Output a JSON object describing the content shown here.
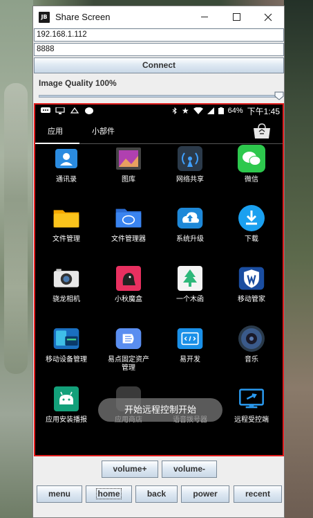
{
  "window": {
    "title": "Share Screen",
    "app_icon_text": "JB"
  },
  "connection": {
    "ip_value": "192.168.1.112",
    "port_value": "8888",
    "connect_label": "Connect"
  },
  "quality": {
    "label": "Image Quality 100%",
    "value_percent": 100
  },
  "phone": {
    "status": {
      "battery": "64%",
      "time": "下午1:45"
    },
    "tabs": [
      "应用",
      "小部件"
    ],
    "apps": [
      {
        "label": "通讯录",
        "icon": "contacts-icon"
      },
      {
        "label": "图库",
        "icon": "gallery-icon"
      },
      {
        "label": "网络共享",
        "icon": "network-share-icon"
      },
      {
        "label": "微信",
        "icon": "wechat-icon"
      },
      {
        "label": "文件管理",
        "icon": "folder-icon"
      },
      {
        "label": "文件管理器",
        "icon": "file-manager-icon"
      },
      {
        "label": "系统升级",
        "icon": "system-update-icon"
      },
      {
        "label": "下载",
        "icon": "download-icon"
      },
      {
        "label": "骁龙相机",
        "icon": "camera-icon"
      },
      {
        "label": "小秋魔盒",
        "icon": "magic-box-icon"
      },
      {
        "label": "一个木函",
        "icon": "tree-icon"
      },
      {
        "label": "移动管家",
        "icon": "shield-icon"
      },
      {
        "label": "移动设备管理",
        "icon": "device-manage-icon"
      },
      {
        "label": "易点固定资产\n管理",
        "icon": "asset-manage-icon"
      },
      {
        "label": "易开发",
        "icon": "dev-icon"
      },
      {
        "label": "音乐",
        "icon": "music-icon"
      },
      {
        "label": "应用安装播报",
        "icon": "android-icon"
      },
      {
        "label": "应用商店",
        "icon": "app-store-icon"
      },
      {
        "label": "语音拨号器",
        "icon": "dialer-icon"
      },
      {
        "label": "远程受控端",
        "icon": "remote-screen-icon"
      }
    ],
    "toast": "开始远程控制开始"
  },
  "controls": {
    "volume_up": "volume+",
    "volume_down": "volume-",
    "menu": "menu",
    "home": "home",
    "back": "back",
    "power": "power",
    "recent": "recent"
  },
  "colors": {
    "phone_border": "#e21d1d",
    "button_gradient_top": "#fdfeff",
    "button_gradient_bottom": "#c9d8e7"
  }
}
